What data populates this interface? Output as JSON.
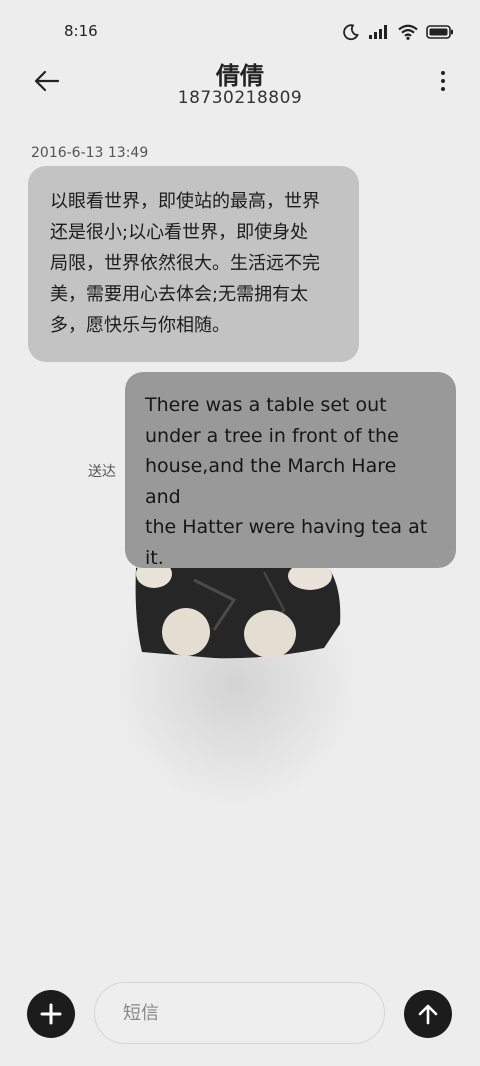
{
  "status_bar": {
    "time": "8:16",
    "icons": [
      "moon-icon",
      "signal-icon",
      "wifi-icon",
      "battery-icon"
    ]
  },
  "header": {
    "contact_name": "倩倩",
    "phone_number": "18730218809",
    "back_icon": "back-arrow-icon",
    "menu_icon": "more-vertical-icon"
  },
  "conversation": {
    "timestamp": "2016-6-13 13:49",
    "incoming": {
      "lines": [
        "以眼看世界，即使站的最高，世界",
        "还是很小;以心看世界，即使身处",
        "局限，世界依然很大。生活远不完",
        "美，需要用心去体会;无需拥有太",
        "多，愿快乐与你相随。"
      ]
    },
    "outgoing": {
      "lines": [
        "There was a table set out",
        "under a tree in front of the",
        "house,and the March Hare and",
        "the Hatter were having tea at",
        "it."
      ],
      "status": "送达"
    }
  },
  "composer": {
    "placeholder": "短信",
    "value": "",
    "add_icon": "plus-icon",
    "send_icon": "send-arrow-icon"
  },
  "colors": {
    "background": "#eeedee",
    "incoming_bubble": "#c4c3c4",
    "outgoing_bubble": "#9a999a",
    "action_button": "#1c1c1c"
  }
}
